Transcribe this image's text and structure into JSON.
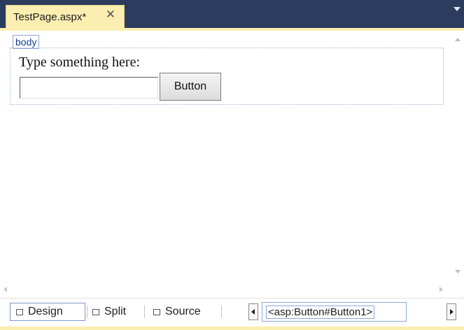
{
  "tab": {
    "title": "TestPage.aspx*",
    "close_glyph": "✕"
  },
  "designer": {
    "body_tag": "body",
    "prompt_text": "Type something here:",
    "textbox_value": "",
    "button_label": "Button"
  },
  "view_modes": {
    "design": "Design",
    "split": "Split",
    "source": "Source",
    "selected": "Design"
  },
  "breadcrumb": {
    "selected": "<asp:Button#Button1>"
  },
  "icons": [
    "close-icon",
    "tab-dropdown-icon",
    "design-view-icon",
    "split-view-icon",
    "source-view-icon",
    "nav-left-icon",
    "nav-right-icon",
    "scroll-up-icon",
    "scroll-down-icon",
    "scroll-left-icon",
    "scroll-right-icon"
  ],
  "colors": {
    "tab_strip": "#2b3c5e",
    "active_tab": "#fbeeb0",
    "tag_border": "#8aa7d8"
  }
}
